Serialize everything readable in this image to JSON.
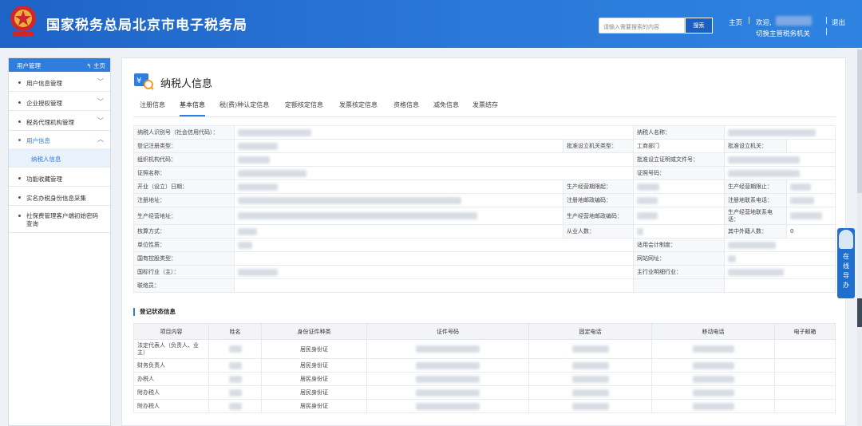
{
  "header": {
    "site_title": "国家税务总局北京市电子税务局",
    "search_placeholder": "请输入需要搜索的内容",
    "search_button": "搜索",
    "home_link": "主页",
    "welcome": "欢迎,",
    "switch_org": "切换主管税务机关",
    "logout": "退出",
    "separator": "|",
    "colors": {
      "bar": "#2a78d8",
      "accent": "#2f7ddc"
    }
  },
  "sidebar": {
    "title": "用户管理",
    "home": "主页",
    "items": [
      {
        "label": "用户信息管理",
        "chevron": "﹀"
      },
      {
        "label": "企业授权管理",
        "chevron": "﹀"
      },
      {
        "label": "税务代理机构管理",
        "chevron": "﹀"
      },
      {
        "label": "用户信息",
        "chevron": "︿"
      },
      {
        "label": "功能收藏管理"
      },
      {
        "label": "实名办税身份信息采集"
      },
      {
        "label": "社保费管理客户端初始密码查询"
      }
    ],
    "subitem": "纳税人信息"
  },
  "main": {
    "title": "纳税人信息",
    "tabs": [
      "注册信息",
      "基本信息",
      "税(费)种认定信息",
      "定额核定信息",
      "发票核定信息",
      "资格信息",
      "减免信息",
      "发票结存"
    ],
    "info": {
      "r1": [
        "纳税人识别号（社会信用代码）：",
        "纳税人名称："
      ],
      "r2": [
        "登记注册类型：",
        "批准设立机关类型：",
        "工商部门",
        "批准设立机关："
      ],
      "r3": [
        "组织机构代码：",
        "批准设立证明或文件号："
      ],
      "r4": [
        "证照名称：",
        "证照号码："
      ],
      "r5": [
        "开业（设立）日期：",
        "生产经营期限起：",
        "生产经营期限止："
      ],
      "r6": [
        "注册地址：",
        "注册地邮政编码：",
        "注册地联系电话："
      ],
      "r7": [
        "生产经营地址：",
        "生产经营地邮政编码：",
        "生产经营地联系电话："
      ],
      "r8": [
        "核算方式：",
        "从业人数：",
        "其中外籍人数：",
        "0"
      ],
      "r9": [
        "单位性质：",
        "适用会计制度："
      ],
      "r10": [
        "国有控股类型：",
        "网站网址："
      ],
      "r11": [
        "国标行业（主）：",
        "主行业明细行业："
      ],
      "r12": [
        "联络员："
      ]
    },
    "reg_section_title": "登记状态信息",
    "reg_table": {
      "headers": [
        "项目内容",
        "姓名",
        "身份证件种类",
        "证件号码",
        "固定电话",
        "移动电话",
        "电子邮箱"
      ],
      "rows": [
        {
          "item": "法定代表人（负责人、业主）",
          "id_type": "居民身份证"
        },
        {
          "item": "财务负责人",
          "id_type": "居民身份证"
        },
        {
          "item": "办税人",
          "id_type": "居民身份证"
        },
        {
          "item": "附办税人",
          "id_type": "居民身份证"
        },
        {
          "item": "附办税人",
          "id_type": "居民身份证"
        }
      ]
    }
  },
  "online_help": {
    "label_1": "在",
    "label_2": "线",
    "label_3": "导",
    "label_4": "办"
  }
}
